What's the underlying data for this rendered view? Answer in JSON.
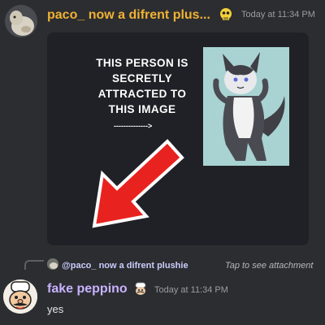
{
  "message1": {
    "username": "paco_ now a difrent plus...",
    "timestamp": "Today at 11:34 PM",
    "avatar_icon": "plushie-avatar",
    "badge_icon": "skull-badge-icon",
    "attachment": {
      "caption_lines": [
        "THIS PERSON IS",
        "SECRETLY",
        "ATTRACTED TO",
        "THIS IMAGE"
      ],
      "caption_arrow": "-------------->",
      "image_subject": "furry-character-drawing",
      "pointer_icon": "red-arrow-icon"
    }
  },
  "reply": {
    "mention": "@paco_ now a difrent plushie",
    "attachment_hint": "Tap to see attachment"
  },
  "message2": {
    "username": "fake peppino",
    "timestamp": "Today at 11:34 PM",
    "text": "yes",
    "avatar_icon": "peppino-avatar",
    "badge_icon": "chef-badge-icon"
  },
  "colors": {
    "background": "#2c2d31",
    "username1": "#f0b232",
    "username2": "#c8b2ff",
    "mention": "#c9cdfb",
    "timestamp": "#9a9ca2",
    "arrow": "#e8231f"
  }
}
